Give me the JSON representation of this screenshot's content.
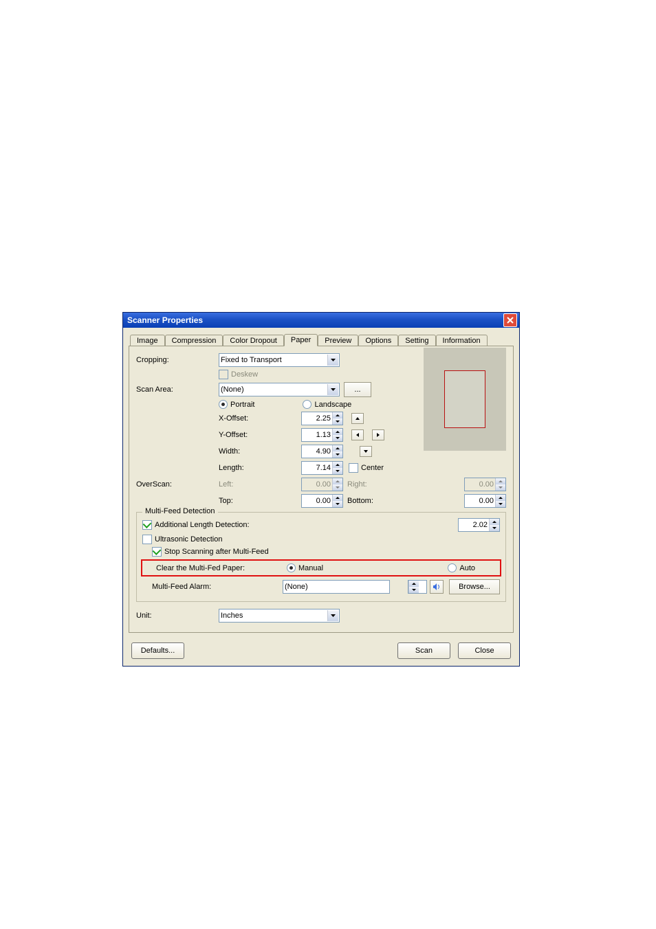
{
  "window": {
    "title": "Scanner Properties"
  },
  "tabs": [
    "Image",
    "Compression",
    "Color Dropout",
    "Paper",
    "Preview",
    "Options",
    "Setting",
    "Information"
  ],
  "active_tab": "Paper",
  "paper": {
    "cropping_label": "Cropping:",
    "cropping_value": "Fixed to Transport",
    "deskew_label": "Deskew",
    "scan_area_label": "Scan Area:",
    "scan_area_value": "(None)",
    "more_btn": "...",
    "portrait_label": "Portrait",
    "landscape_label": "Landscape",
    "xoffset_label": "X-Offset:",
    "xoffset_value": "2.25",
    "yoffset_label": "Y-Offset:",
    "yoffset_value": "1.13",
    "width_label": "Width:",
    "width_value": "4.90",
    "length_label": "Length:",
    "length_value": "7.14",
    "center_label": "Center"
  },
  "overscan": {
    "label": "OverScan:",
    "left_label": "Left:",
    "left_value": "0.00",
    "right_label": "Right:",
    "right_value": "0.00",
    "top_label": "Top:",
    "top_value": "0.00",
    "bottom_label": "Bottom:",
    "bottom_value": "0.00"
  },
  "multifeed": {
    "legend": "Multi-Feed Detection",
    "addlen_label": "Additional Length Detection:",
    "addlen_value": "2.02",
    "ultrasonic_label": "Ultrasonic Detection",
    "stop_label": "Stop Scanning after Multi-Feed",
    "clear_label": "Clear the Multi-Fed Paper:",
    "manual_label": "Manual",
    "auto_label": "Auto",
    "alarm_label": "Multi-Feed Alarm:",
    "alarm_value": "(None)",
    "browse_label": "Browse..."
  },
  "unit": {
    "label": "Unit:",
    "value": "Inches"
  },
  "buttons": {
    "defaults": "Defaults...",
    "scan": "Scan",
    "close": "Close"
  }
}
